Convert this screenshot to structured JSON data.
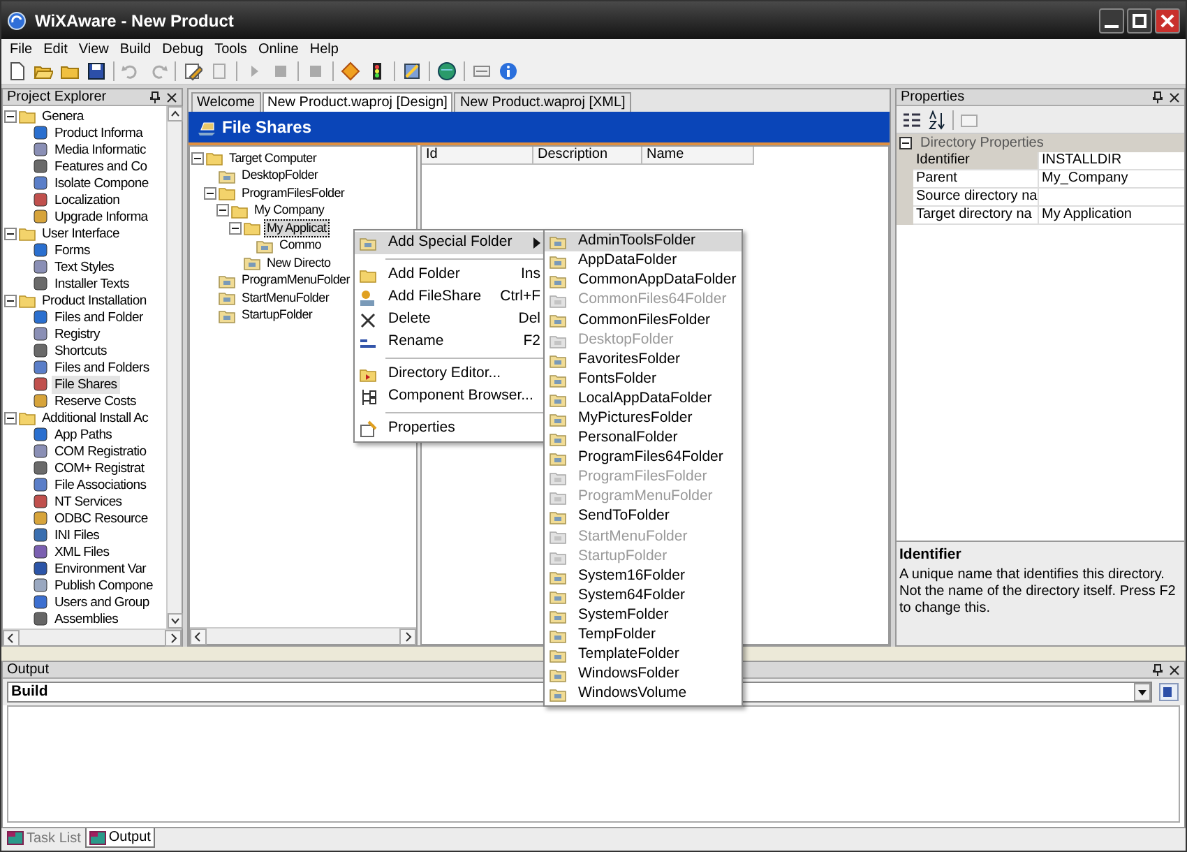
{
  "window": {
    "title": "WiXAware - New Product"
  },
  "menu": [
    "File",
    "Edit",
    "View",
    "Build",
    "Debug",
    "Tools",
    "Online",
    "Help"
  ],
  "project_explorer": {
    "title": "Project Explorer",
    "tree": [
      {
        "label": "Genera",
        "expanded": true,
        "selected": false,
        "children": [
          {
            "label": "Product Informa",
            "selected": false
          },
          {
            "label": "Media Informatic",
            "selected": false
          },
          {
            "label": "Features and Co",
            "selected": false
          },
          {
            "label": "Isolate Compone",
            "selected": false
          },
          {
            "label": "Localization",
            "selected": false
          },
          {
            "label": "Upgrade Informa",
            "selected": false
          }
        ]
      },
      {
        "label": "User Interface",
        "expanded": true,
        "selected": false,
        "children": [
          {
            "label": "Forms",
            "selected": false
          },
          {
            "label": "Text Styles",
            "selected": false
          },
          {
            "label": "Installer Texts",
            "selected": false
          }
        ]
      },
      {
        "label": "Product Installation",
        "expanded": true,
        "selected": false,
        "children": [
          {
            "label": "Files and Folder",
            "selected": false
          },
          {
            "label": "Registry",
            "selected": false
          },
          {
            "label": "Shortcuts",
            "selected": false
          },
          {
            "label": "Files and Folders",
            "selected": false
          },
          {
            "label": "File Shares",
            "selected": true
          },
          {
            "label": "Reserve Costs",
            "selected": false
          }
        ]
      },
      {
        "label": "Additional Install Ac",
        "expanded": true,
        "selected": false,
        "children": [
          {
            "label": "App Paths",
            "selected": false
          },
          {
            "label": "COM Registratio",
            "selected": false
          },
          {
            "label": "COM+ Registrat",
            "selected": false
          },
          {
            "label": "File Associations",
            "selected": false
          },
          {
            "label": "NT Services",
            "selected": false
          },
          {
            "label": "ODBC Resource",
            "selected": false
          },
          {
            "label": "INI Files",
            "selected": false
          },
          {
            "label": "XML Files",
            "selected": false
          },
          {
            "label": "Environment Var",
            "selected": false
          },
          {
            "label": "Publish Compone",
            "selected": false
          },
          {
            "label": "Users and Group",
            "selected": false
          },
          {
            "label": "Assemblies",
            "selected": false
          }
        ]
      }
    ]
  },
  "document_tabs": [
    {
      "label": "Welcome",
      "selected": false
    },
    {
      "label": "New Product.waproj [Design]",
      "selected": true
    },
    {
      "label": "New Product.waproj [XML]",
      "selected": false
    }
  ],
  "file_shares": {
    "title": "File Shares",
    "tree": [
      {
        "label": "Target Computer",
        "expanded": true,
        "selected": false,
        "children": [
          {
            "label": "DesktopFolder",
            "selected": false
          },
          {
            "label": "ProgramFilesFolder",
            "expanded": true,
            "selected": false,
            "children": [
              {
                "label": "My Company",
                "expanded": true,
                "selected": false,
                "children": [
                  {
                    "label": "My Applicat",
                    "expanded": true,
                    "selected": true,
                    "children": [
                      {
                        "label": "Commo",
                        "selected": false
                      }
                    ]
                  },
                  {
                    "label": "New Directo",
                    "selected": false
                  }
                ]
              }
            ]
          },
          {
            "label": "ProgramMenuFolder",
            "selected": false
          },
          {
            "label": "StartMenuFolder",
            "selected": false
          },
          {
            "label": "StartupFolder",
            "selected": false
          }
        ]
      }
    ],
    "columns": [
      "Id",
      "Description",
      "Name"
    ]
  },
  "context_menu": [
    {
      "kind": "item",
      "label": "Add Special Folder",
      "submenu": true,
      "selected": true
    },
    {
      "kind": "separator"
    },
    {
      "kind": "item",
      "label": "Add Folder",
      "shortcut": "Ins",
      "selected": false
    },
    {
      "kind": "item",
      "label": "Add FileShare",
      "shortcut": "Ctrl+F",
      "selected": false
    },
    {
      "kind": "item",
      "label": "Delete",
      "shortcut": "Del",
      "selected": false
    },
    {
      "kind": "item",
      "label": "Rename",
      "shortcut": "F2",
      "selected": false
    },
    {
      "kind": "separator"
    },
    {
      "kind": "item",
      "label": "Directory Editor...",
      "selected": false
    },
    {
      "kind": "item",
      "label": "Component Browser...",
      "selected": false
    },
    {
      "kind": "separator"
    },
    {
      "kind": "item",
      "label": "Properties",
      "selected": false
    }
  ],
  "special_folder_menu": [
    {
      "label": "AdminToolsFolder",
      "selected": true,
      "disabled": false
    },
    {
      "label": "AppDataFolder",
      "selected": false,
      "disabled": false
    },
    {
      "label": "CommonAppDataFolder",
      "selected": false,
      "disabled": false
    },
    {
      "label": "CommonFiles64Folder",
      "selected": false,
      "disabled": true
    },
    {
      "label": "CommonFilesFolder",
      "selected": false,
      "disabled": false
    },
    {
      "label": "DesktopFolder",
      "selected": false,
      "disabled": true
    },
    {
      "label": "FavoritesFolder",
      "selected": false,
      "disabled": false
    },
    {
      "label": "FontsFolder",
      "selected": false,
      "disabled": false
    },
    {
      "label": "LocalAppDataFolder",
      "selected": false,
      "disabled": false
    },
    {
      "label": "MyPicturesFolder",
      "selected": false,
      "disabled": false
    },
    {
      "label": "PersonalFolder",
      "selected": false,
      "disabled": false
    },
    {
      "label": "ProgramFiles64Folder",
      "selected": false,
      "disabled": false
    },
    {
      "label": "ProgramFilesFolder",
      "selected": false,
      "disabled": true
    },
    {
      "label": "ProgramMenuFolder",
      "selected": false,
      "disabled": true
    },
    {
      "label": "SendToFolder",
      "selected": false,
      "disabled": false
    },
    {
      "label": "StartMenuFolder",
      "selected": false,
      "disabled": true
    },
    {
      "label": "StartupFolder",
      "selected": false,
      "disabled": true
    },
    {
      "label": "System16Folder",
      "selected": false,
      "disabled": false
    },
    {
      "label": "System64Folder",
      "selected": false,
      "disabled": false
    },
    {
      "label": "SystemFolder",
      "selected": false,
      "disabled": false
    },
    {
      "label": "TempFolder",
      "selected": false,
      "disabled": false
    },
    {
      "label": "TemplateFolder",
      "selected": false,
      "disabled": false
    },
    {
      "label": "WindowsFolder",
      "selected": false,
      "disabled": false
    },
    {
      "label": "WindowsVolume",
      "selected": false,
      "disabled": false
    }
  ],
  "properties": {
    "title": "Properties",
    "category": {
      "label": "Directory Properties",
      "expanded": true
    },
    "rows": [
      {
        "name": "Identifier",
        "value": "INSTALLDIR",
        "selected": true
      },
      {
        "name": "Parent",
        "value": "My_Company",
        "selected": false
      },
      {
        "name": "Source directory na",
        "selected": false
      },
      {
        "name": "Target directory na",
        "value": "My Application",
        "selected": false
      }
    ],
    "description_title": "Identifier",
    "description": "A unique name that identifies this directory. Not the name of the directory itself. Press F2 to change this."
  },
  "output": {
    "title": "Output",
    "source": "Build"
  },
  "bottom_tabs": [
    {
      "label": "Task List",
      "selected": false
    },
    {
      "label": "Output",
      "selected": true
    }
  ]
}
